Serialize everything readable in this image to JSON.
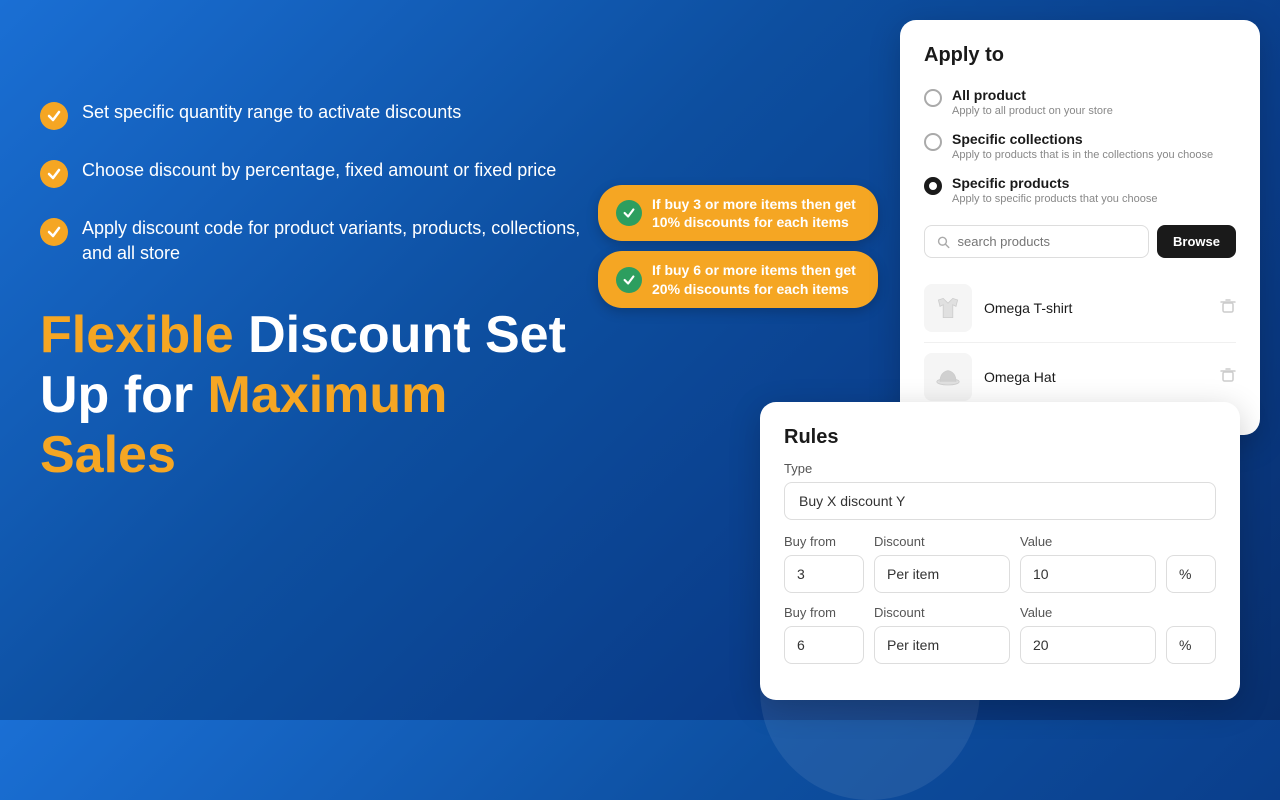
{
  "background": {
    "gradient_start": "#1a6fd4",
    "gradient_end": "#082f6e"
  },
  "features": [
    {
      "id": "feature-1",
      "text": "Set specific quantity range to activate discounts"
    },
    {
      "id": "feature-2",
      "text": "Choose discount by percentage, fixed amount or fixed price"
    },
    {
      "id": "feature-3",
      "text": "Apply discount code for product variants, products, collections, and all store"
    }
  ],
  "headline": {
    "line1_regular": "Flexible ",
    "line1_highlight": "Discount Set",
    "line2_regular": "Up for ",
    "line2_highlight": "Maximum",
    "line3_highlight": "Sales"
  },
  "badges": [
    {
      "id": "badge-1",
      "text": "If buy 3 or more items then get 10% discounts for each items"
    },
    {
      "id": "badge-2",
      "text": "If buy 6 or more items then get 20% discounts for each items"
    }
  ],
  "apply_card": {
    "title": "Apply to",
    "options": [
      {
        "id": "all-product",
        "label": "All product",
        "description": "Apply to all product on your store",
        "selected": false
      },
      {
        "id": "specific-collections",
        "label": "Specific collections",
        "description": "Apply to products that is in the collections you choose",
        "selected": false
      },
      {
        "id": "specific-products",
        "label": "Specific products",
        "description": "Apply to specific products that you choose",
        "selected": true
      }
    ],
    "search_placeholder": "search products",
    "browse_label": "Browse",
    "products": [
      {
        "id": "product-1",
        "name": "Omega T-shirt"
      },
      {
        "id": "product-2",
        "name": "Omega Hat"
      }
    ]
  },
  "rules_card": {
    "title": "Rules",
    "type_label": "Type",
    "type_value": "Buy X discount Y",
    "rows": [
      {
        "id": "row-1",
        "buy_from_label": "Buy from",
        "buy_from_value": "3",
        "discount_label": "Discount",
        "discount_value": "Per item",
        "value_label": "Value",
        "value_value": "10",
        "unit_value": "%"
      },
      {
        "id": "row-2",
        "buy_from_label": "Buy from",
        "buy_from_value": "6",
        "discount_label": "Discount",
        "discount_value": "Per item",
        "value_label": "Value",
        "value_value": "20",
        "unit_value": "%"
      }
    ]
  }
}
